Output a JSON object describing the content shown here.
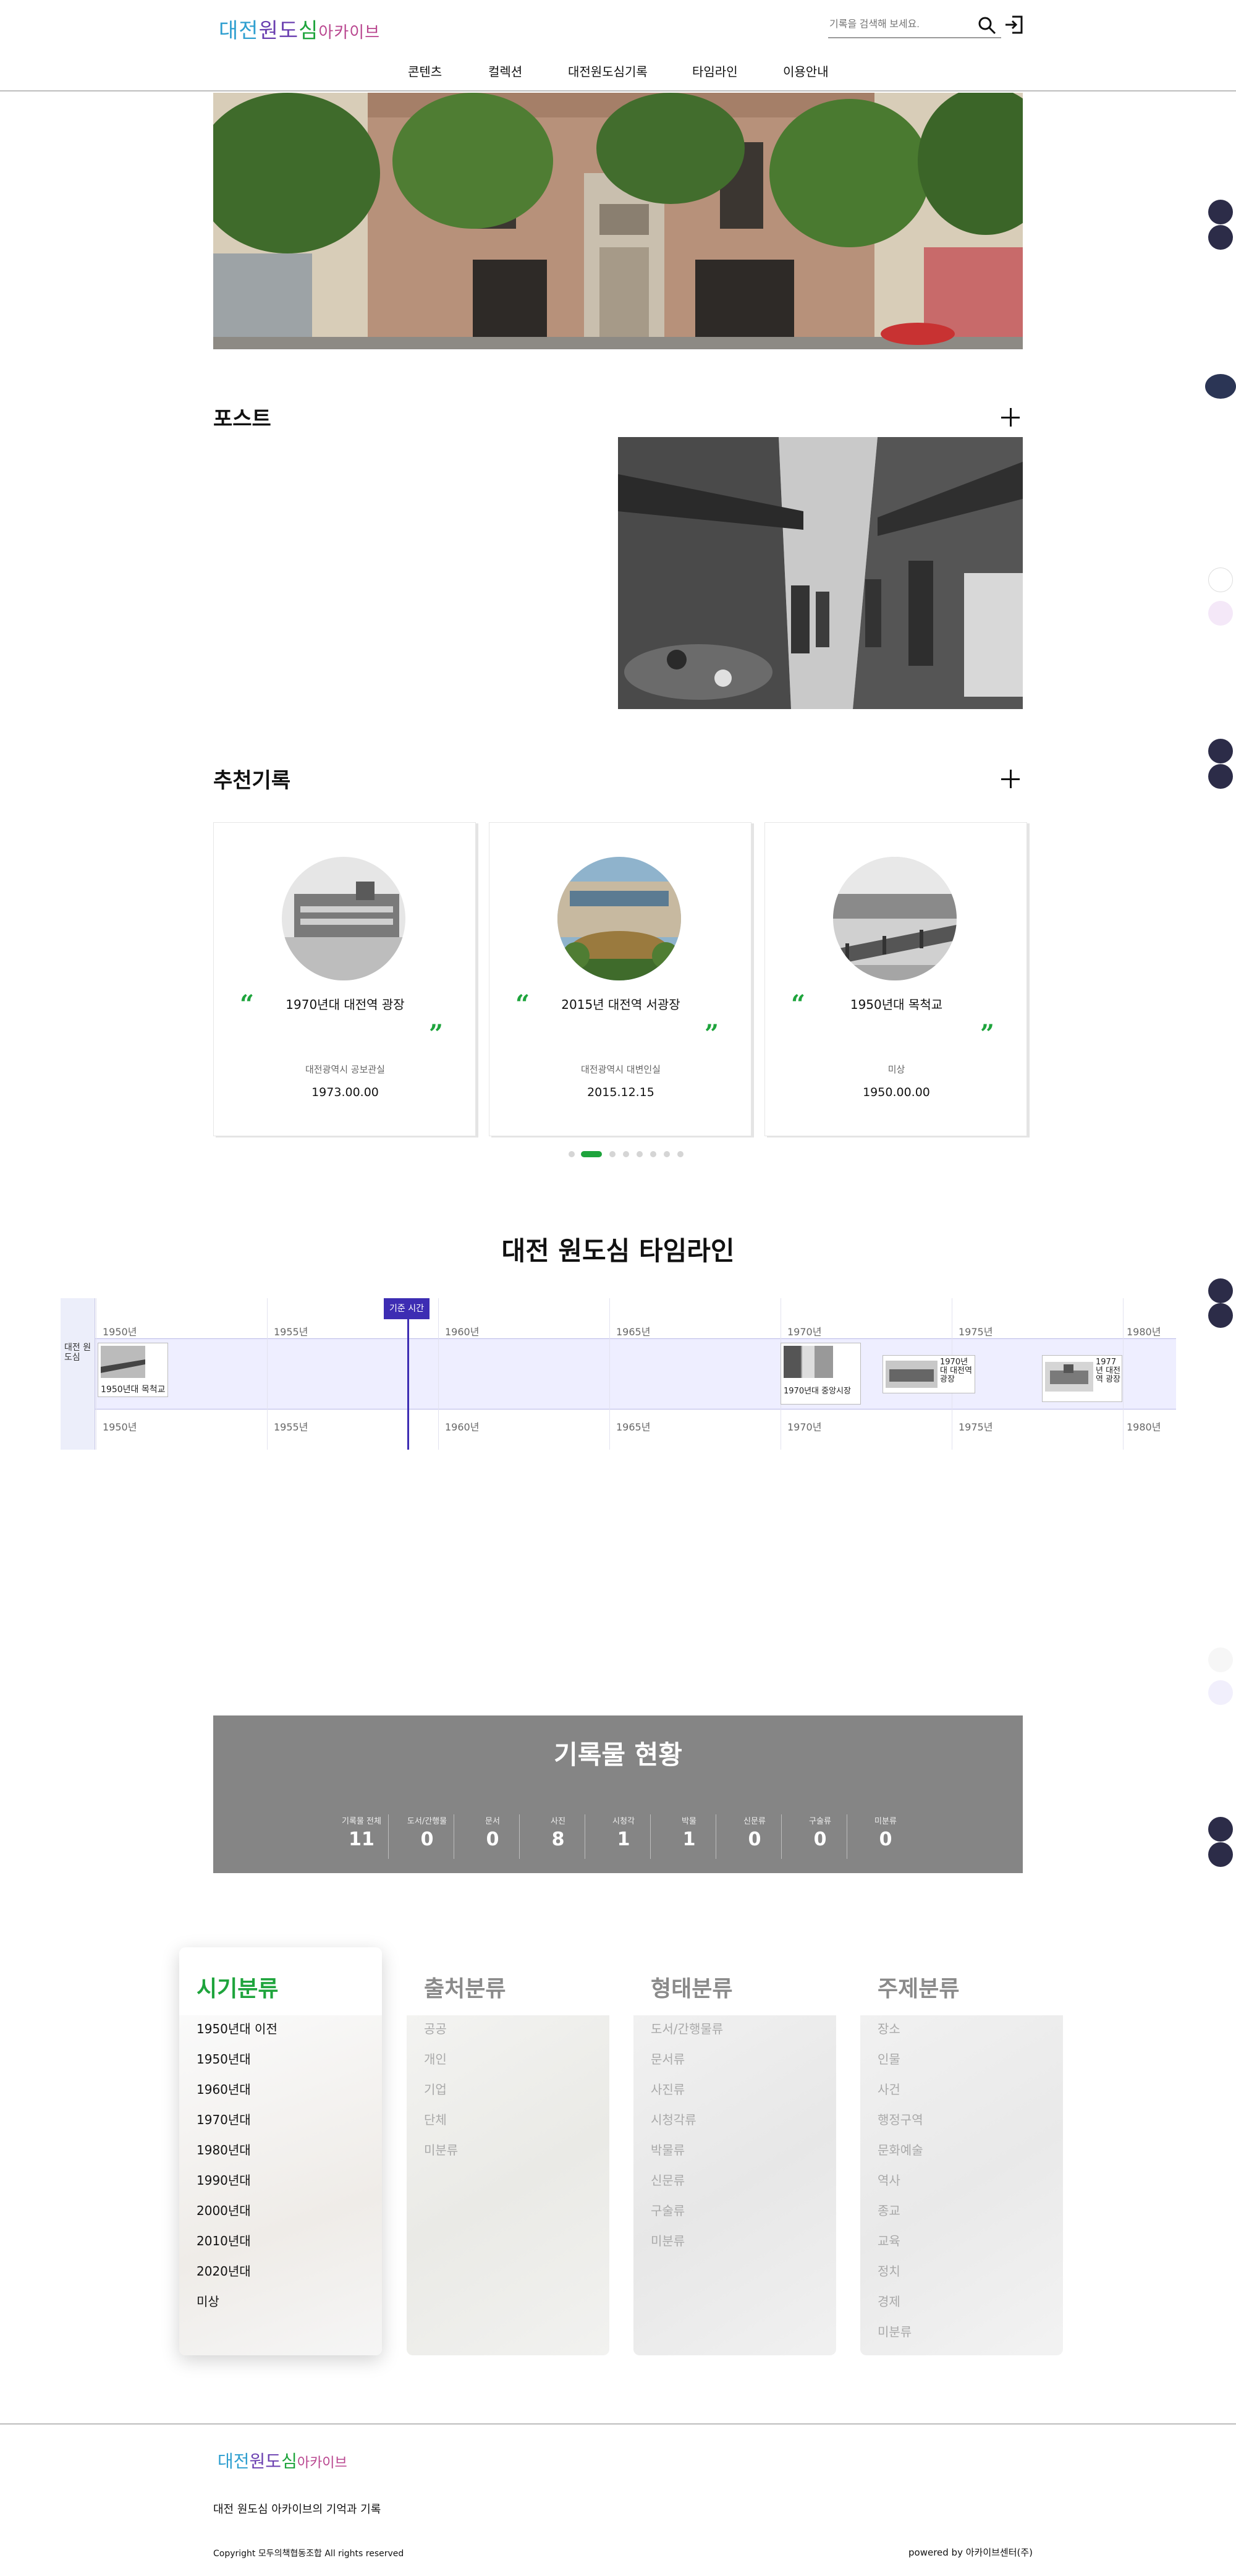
{
  "header": {
    "logo_text": "대전원도심아카이브",
    "search_placeholder": "기록을 검색해 보세요.",
    "nav": [
      "콘텐츠",
      "컬렉션",
      "대전원도심기록",
      "타임라인",
      "이용안내"
    ]
  },
  "post": {
    "title": "포스트"
  },
  "recommend": {
    "title": "추천기록",
    "cards": [
      {
        "title": "1970년대 대전역 광장",
        "source": "대전광역시 공보관실",
        "date": "1973.00.00"
      },
      {
        "title": "2015년 대전역 서광장",
        "source": "대전광역시 대변인실",
        "date": "2015.12.15"
      },
      {
        "title": "1950년대 목척교",
        "source": "미상",
        "date": "1950.00.00"
      }
    ],
    "dot_count": 8,
    "active_dot": 1
  },
  "timeline": {
    "title": "대전 원도심 타임라인",
    "row_label": "대전 원도심",
    "now_label": "기준 시간",
    "years": [
      "1950년",
      "1955년",
      "1960년",
      "1965년",
      "1970년",
      "1975년",
      "1980년"
    ],
    "items": [
      {
        "label": "1950년대 목척교"
      },
      {
        "label": "1970년대 중앙시장"
      },
      {
        "label": "1970년대 대전역 광장"
      },
      {
        "label": "1977년 대전역 광장"
      }
    ]
  },
  "stats": {
    "title": "기록물 현황",
    "items": [
      {
        "label": "기록물 전체",
        "value": "11"
      },
      {
        "label": "도서/간행물",
        "value": "0"
      },
      {
        "label": "문서",
        "value": "0"
      },
      {
        "label": "사진",
        "value": "8"
      },
      {
        "label": "시청각",
        "value": "1"
      },
      {
        "label": "박물",
        "value": "1"
      },
      {
        "label": "신문류",
        "value": "0"
      },
      {
        "label": "구술류",
        "value": "0"
      },
      {
        "label": "미분류",
        "value": "0"
      }
    ]
  },
  "classification": [
    {
      "title": "시기분류",
      "items": [
        "1950년대 이전",
        "1950년대",
        "1960년대",
        "1970년대",
        "1980년대",
        "1990년대",
        "2000년대",
        "2010년대",
        "2020년대",
        "미상"
      ]
    },
    {
      "title": "출처분류",
      "items": [
        "공공",
        "개인",
        "기업",
        "단체",
        "미분류"
      ]
    },
    {
      "title": "형태분류",
      "items": [
        "도서/간행물류",
        "문서류",
        "사진류",
        "시청각류",
        "박물류",
        "신문류",
        "구술류",
        "미분류"
      ]
    },
    {
      "title": "주제분류",
      "items": [
        "장소",
        "인물",
        "사건",
        "행정구역",
        "문화예술",
        "역사",
        "종교",
        "교육",
        "정치",
        "경제",
        "미분류"
      ]
    }
  ],
  "footer": {
    "logo_text": "대전원도심아카이브",
    "slogan": "대전 원도심 아카이브의 기억과 기록",
    "copyright": "Copyright 모두의책협동조합 All rights reserved",
    "powered": "powered by 아카이브센터(주)"
  },
  "colors": {
    "accent": "#1ea43c",
    "timeline": "#3d2db3",
    "stats_bg": "#858585"
  }
}
